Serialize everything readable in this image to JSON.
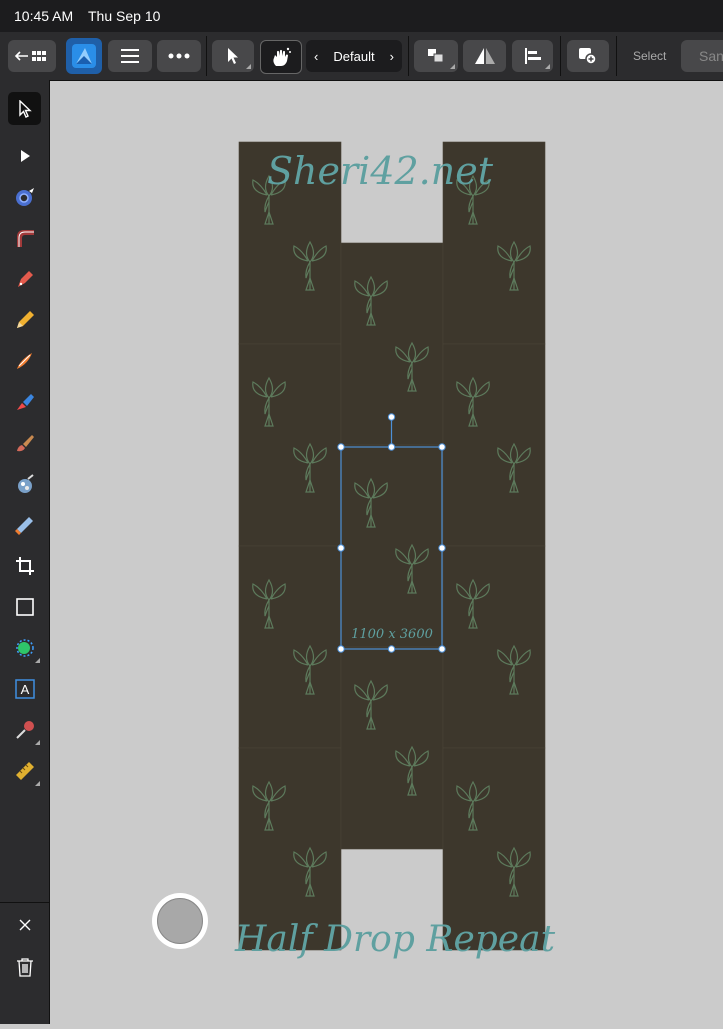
{
  "status": {
    "time": "10:45 AM",
    "date": "Thu Sep 10"
  },
  "toolbar": {
    "back_icon": "back-grid-icon",
    "app_icon": "affinity-designer-icon",
    "menu_icon": "hamburger-icon",
    "more_icon": "more-dots-icon",
    "move_tool_icon": "pointer-icon",
    "hand_icon": "touch-hand-icon",
    "preset_label": "Default",
    "arrange_icon": "arrange-icon",
    "flip_icon": "flip-icon",
    "align_icon": "align-left-icon",
    "add_icon": "add-shape-icon",
    "select_label": "Select",
    "same_label": "San"
  },
  "tools": [
    {
      "name": "move-tool",
      "icon": "arrow-cursor-icon"
    },
    {
      "name": "node-tool",
      "icon": "node-arrow-icon"
    },
    {
      "name": "contour-tool",
      "icon": "contour-icon"
    },
    {
      "name": "corner-tool",
      "icon": "corner-icon"
    },
    {
      "name": "pen-tool",
      "icon": "pen-icon"
    },
    {
      "name": "pencil-tool",
      "icon": "pencil-icon"
    },
    {
      "name": "vector-brush-tool",
      "icon": "vector-brush-icon"
    },
    {
      "name": "fill-tool",
      "icon": "fill-icon"
    },
    {
      "name": "pixel-brush-tool",
      "icon": "brush-icon"
    },
    {
      "name": "paint-mixer-tool",
      "icon": "mixer-icon"
    },
    {
      "name": "transparency-tool",
      "icon": "gradient-icon"
    },
    {
      "name": "crop-tool",
      "icon": "crop-icon"
    },
    {
      "name": "rectangle-tool",
      "icon": "rectangle-icon"
    },
    {
      "name": "shape-tool",
      "icon": "shape-icon"
    },
    {
      "name": "text-tool",
      "icon": "text-icon"
    },
    {
      "name": "color-picker-tool",
      "icon": "eyedropper-icon"
    },
    {
      "name": "measure-tool",
      "icon": "ruler-icon"
    }
  ],
  "bottom_tools": {
    "close_icon": "close-icon",
    "trash_icon": "trash-icon"
  },
  "canvas": {
    "watermark": "Sheri42.net",
    "dimension_label": "1100 x 3600",
    "caption": "Half Drop Repeat",
    "tile_color": "#3d372c",
    "motif_color": "#5d7a5c",
    "selection_color": "#4d8fd6",
    "text_color": "#5fa0a0"
  }
}
